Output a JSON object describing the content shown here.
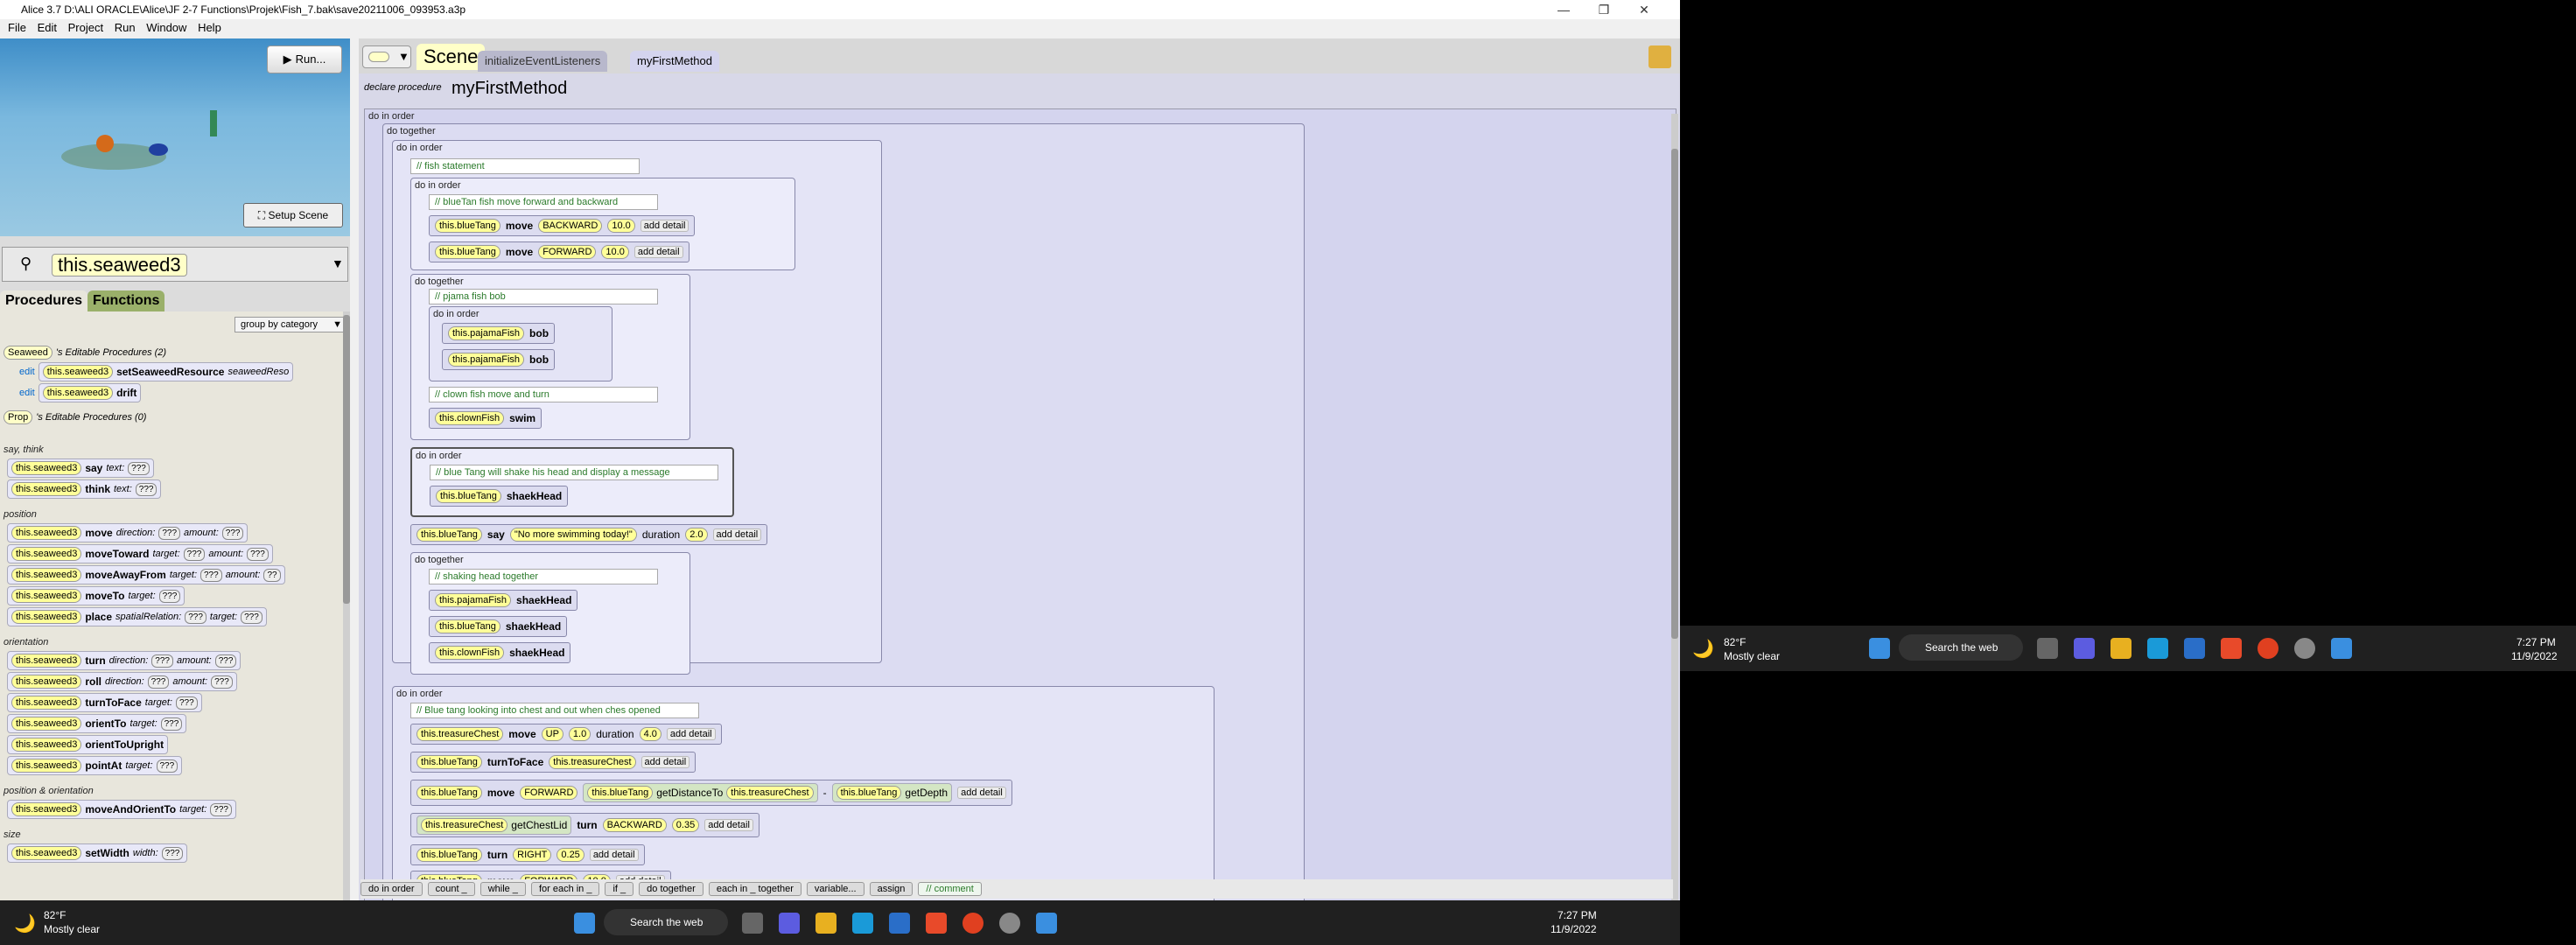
{
  "window": {
    "title": "Alice 3.7 D:\\ALI ORACLE\\Alice\\JF 2-7 Functions\\Projek\\Fish_7.bak\\save20211006_093953.a3p"
  },
  "menu": [
    "File",
    "Edit",
    "Project",
    "Run",
    "Window",
    "Help"
  ],
  "scene_panel": {
    "run_label": "Run...",
    "setup_label": "Setup Scene"
  },
  "selected_object": "this.seaweed3",
  "left_tabs": {
    "procedures": "Procedures",
    "functions": "Functions"
  },
  "group_select": "group by category",
  "editable": {
    "class_name": "Seaweed",
    "header": "'s Editable Procedures (2)",
    "edit": "edit",
    "items": [
      {
        "target": "this.seaweed3",
        "method": "setSeaweedResource",
        "param": "seaweedReso"
      },
      {
        "target": "this.seaweed3",
        "method": "drift"
      }
    ],
    "prop_name": "Prop",
    "prop_header": "'s Editable Procedures (0)"
  },
  "categories": {
    "say_think": "say, think",
    "position": "position",
    "orientation": "orientation",
    "pos_orient": "position & orientation",
    "size": "size"
  },
  "procedures": {
    "say": {
      "t": "this.seaweed3",
      "m": "say",
      "p": "text:",
      "v": "???"
    },
    "think": {
      "t": "this.seaweed3",
      "m": "think",
      "p": "text:",
      "v": "???"
    },
    "move": {
      "t": "this.seaweed3",
      "m": "move",
      "p": "direction:",
      "v": "???",
      "p2": "amount:",
      "v2": "???"
    },
    "moveToward": {
      "t": "this.seaweed3",
      "m": "moveToward",
      "p": "target:",
      "v": "???",
      "p2": "amount:",
      "v2": "???"
    },
    "moveAwayFrom": {
      "t": "this.seaweed3",
      "m": "moveAwayFrom",
      "p": "target:",
      "v": "???",
      "p2": "amount:",
      "v2": "??"
    },
    "moveTo": {
      "t": "this.seaweed3",
      "m": "moveTo",
      "p": "target:",
      "v": "???"
    },
    "place": {
      "t": "this.seaweed3",
      "m": "place",
      "p": "spatialRelation:",
      "v": "???",
      "p2": "target:",
      "v2": "???"
    },
    "turn": {
      "t": "this.seaweed3",
      "m": "turn",
      "p": "direction:",
      "v": "???",
      "p2": "amount:",
      "v2": "???"
    },
    "roll": {
      "t": "this.seaweed3",
      "m": "roll",
      "p": "direction:",
      "v": "???",
      "p2": "amount:",
      "v2": "???"
    },
    "turnToFace": {
      "t": "this.seaweed3",
      "m": "turnToFace",
      "p": "target:",
      "v": "???"
    },
    "orientTo": {
      "t": "this.seaweed3",
      "m": "orientTo",
      "p": "target:",
      "v": "???"
    },
    "orientToUpright": {
      "t": "this.seaweed3",
      "m": "orientToUpright"
    },
    "pointAt": {
      "t": "this.seaweed3",
      "m": "pointAt",
      "p": "target:",
      "v": "???"
    },
    "moveAndOrientTo": {
      "t": "this.seaweed3",
      "m": "moveAndOrientTo",
      "p": "target:",
      "v": "???"
    },
    "setWidth": {
      "t": "this.seaweed3",
      "m": "setWidth",
      "p": "width:",
      "v": "???"
    }
  },
  "editor_tabs": {
    "scene": "Scene",
    "init": "initializeEventListeners",
    "method": "myFirstMethod"
  },
  "declare": {
    "prefix": "declare procedure",
    "name": "myFirstMethod"
  },
  "code": {
    "do_in_order": "do in order",
    "do_together": "do together",
    "add_detail": "add detail",
    "c1": "// fish statement",
    "c2": "// blueTan fish move forward and backward",
    "c3": "// pjama fish bob",
    "c4": "// clown fish move and turn",
    "c5": "// blue Tang will shake his head and display a message",
    "c6": "// shaking head together",
    "c7": "// Blue tang looking into chest and out when ches opened",
    "blueTang": "this.blueTang",
    "pajamaFish": "this.pajamaFish",
    "clownFish": "this.clownFish",
    "treasureChest": "this.treasureChest",
    "move": "move",
    "bob": "bob",
    "swim": "swim",
    "shaekHead": "shaekHead",
    "say": "say",
    "turnToFace": "turnToFace",
    "turn": "turn",
    "getDistanceTo": "getDistanceTo",
    "getDepth": "getDepth",
    "getChestLid": "getChestLid",
    "BACKWARD": "BACKWARD",
    "FORWARD": "FORWARD",
    "UP": "UP",
    "RIGHT": "RIGHT",
    "v10": "10.0",
    "v1": "1.0",
    "v4": "4.0",
    "v2": "2.0",
    "v035": "0.35",
    "v025": "0.25",
    "sayText": "\"No more swimming today!\"",
    "duration": "duration",
    "minus": "-"
  },
  "bottom_blocks": [
    "do in order",
    "count _",
    "while _",
    "for each in _",
    "if _",
    "do together",
    "each in _ together",
    "variable...",
    "assign",
    "// comment"
  ],
  "taskbar": {
    "weather_temp": "82°F",
    "weather_desc": "Mostly clear",
    "search": "Search the web",
    "time": "7:27 PM",
    "date": "11/9/2022"
  }
}
